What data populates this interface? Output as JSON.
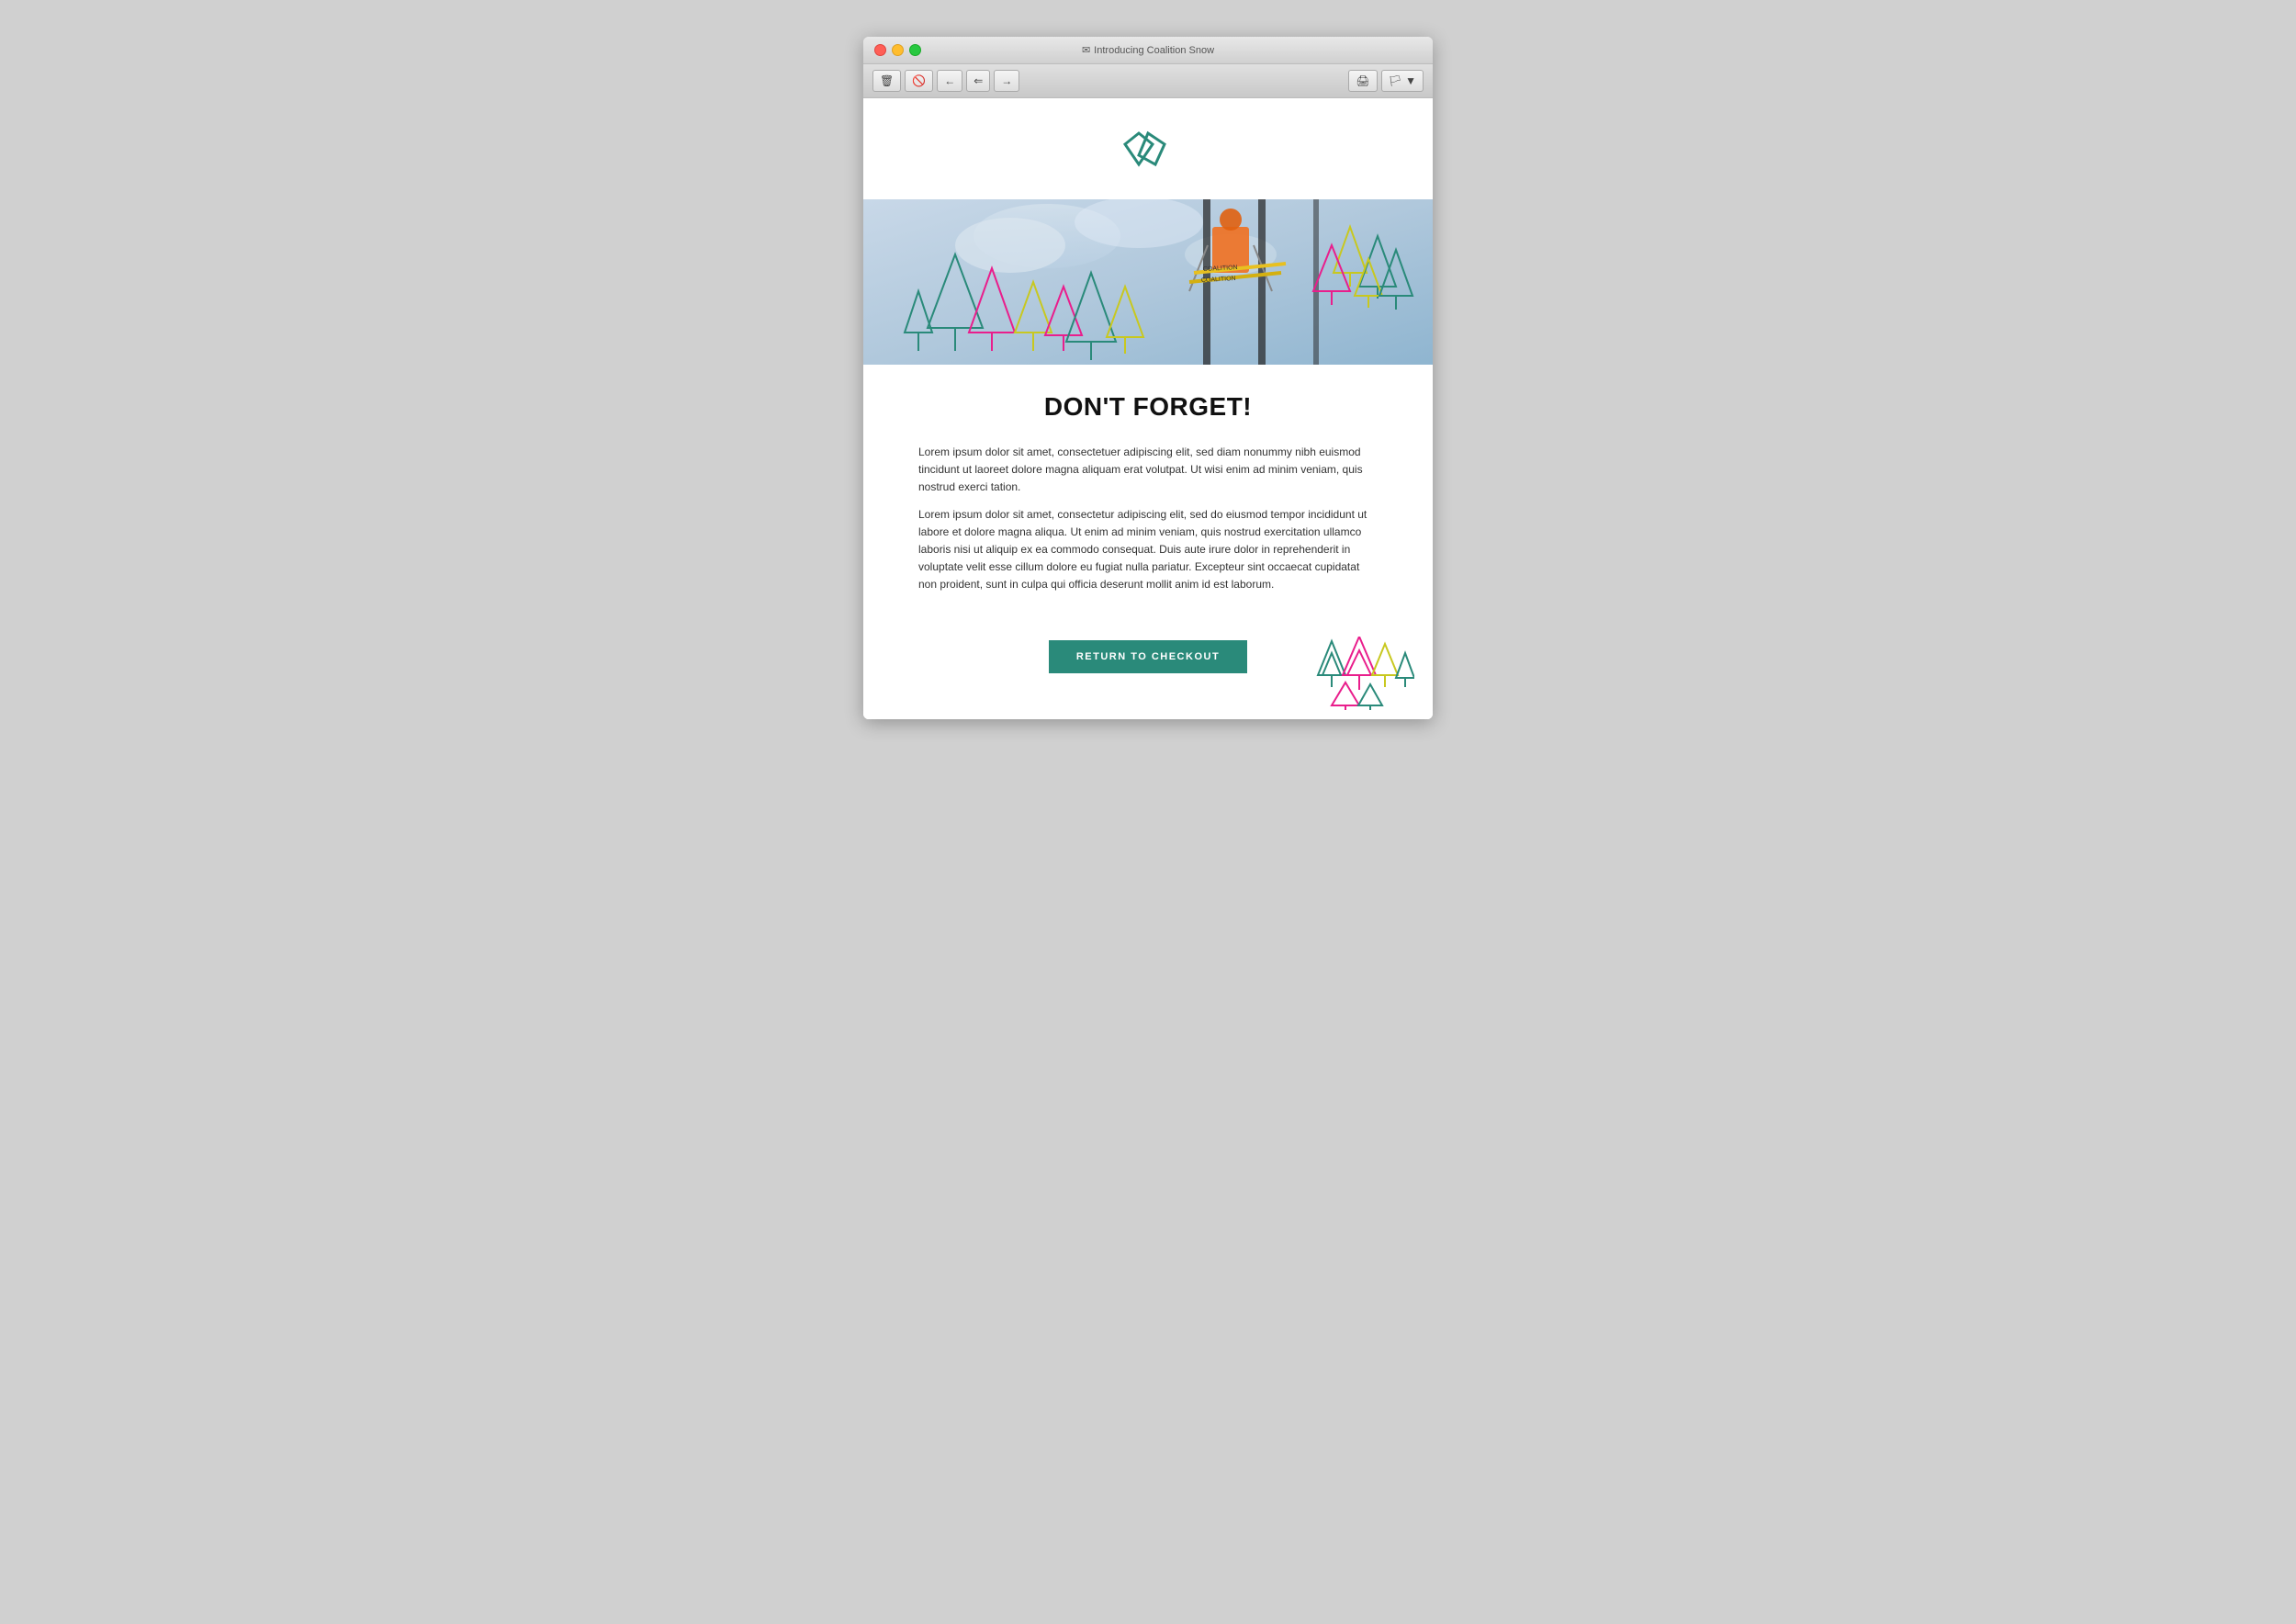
{
  "browser": {
    "title": "Introducing Coalition Snow",
    "title_icon": "✉",
    "traffic_lights": [
      "red",
      "yellow",
      "green"
    ]
  },
  "toolbar": {
    "buttons": [
      "🗑",
      "🚫",
      "←",
      "⇐",
      "→"
    ],
    "right_buttons": [
      "🖨",
      "🏳"
    ]
  },
  "email": {
    "heading": "DON'T FORGET!",
    "body_paragraph1": "Lorem ipsum dolor sit amet, consectetuer adipiscing elit, sed diam nonummy nibh euismod tincidunt ut laoreet dolore magna aliquam erat volutpat. Ut wisi enim ad minim veniam, quis nostrud exerci tation.",
    "body_paragraph2": "Lorem ipsum dolor sit amet, consectetur adipiscing elit, sed do eiusmod tempor incididunt ut labore et dolore magna aliqua. Ut enim ad minim veniam, quis nostrud exercitation ullamco laboris nisi ut aliquip ex ea commodo consequat. Duis aute irure dolor in reprehenderit in voluptate velit esse cillum dolore eu fugiat nulla pariatur. Excepteur sint occaecat cupidatat non proident, sunt in culpa qui officia deserunt mollit anim id est laborum.",
    "cta_button": "RETURN TO CHECKOUT",
    "brand_color": "#2a8a7a",
    "logo_color": "#2a8a7a"
  },
  "colors": {
    "teal": "#2a8a7a",
    "magenta": "#e91e8c",
    "yellow": "#d4d62a",
    "light_teal": "#3ab8a0"
  }
}
